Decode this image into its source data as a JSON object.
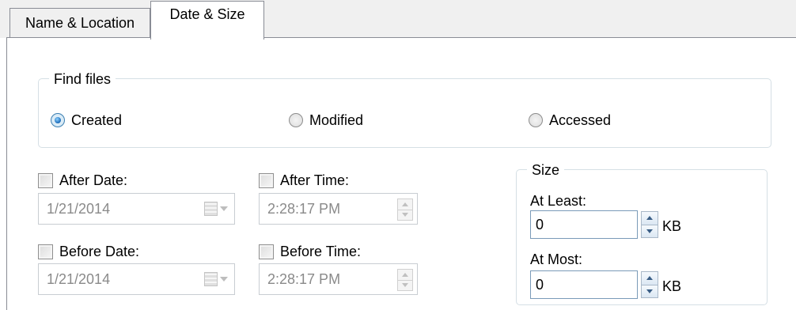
{
  "tabs": [
    {
      "label": "Name & Location",
      "active": false
    },
    {
      "label": "Date & Size",
      "active": true
    }
  ],
  "find_files": {
    "legend": "Find files",
    "options": [
      {
        "label": "Created",
        "checked": true
      },
      {
        "label": "Modified",
        "checked": false
      },
      {
        "label": "Accessed",
        "checked": false
      }
    ]
  },
  "after_date": {
    "label": "After Date:",
    "checked": false,
    "value": "1/21/2014"
  },
  "before_date": {
    "label": "Before Date:",
    "checked": false,
    "value": "1/21/2014"
  },
  "after_time": {
    "label": "After Time:",
    "checked": false,
    "value": "2:28:17 PM"
  },
  "before_time": {
    "label": "Before Time:",
    "checked": false,
    "value": "2:28:17 PM"
  },
  "size": {
    "legend": "Size",
    "at_least": {
      "label": "At Least:",
      "value": "0",
      "unit": "KB"
    },
    "at_most": {
      "label": "At Most:",
      "value": "0",
      "unit": "KB"
    }
  },
  "colors": {
    "tab_border": "#898c95",
    "groupbox_border": "#d5dfe5",
    "disabled_text": "#8a8a8a",
    "radio_accent": "#1769b8"
  },
  "icons": [
    "calendar-dropdown-icon",
    "spin-up-icon",
    "spin-down-icon"
  ]
}
